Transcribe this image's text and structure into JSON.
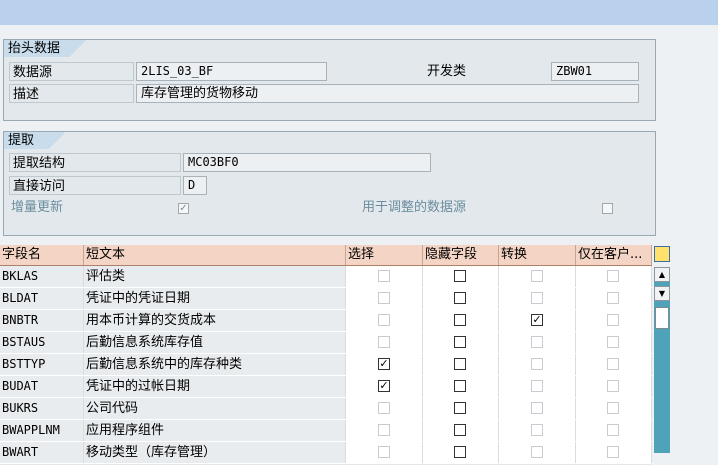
{
  "header_group": {
    "title": "抬头数据",
    "datasource_label": "数据源",
    "datasource_value": "2LIS_03_BF",
    "devclass_label": "开发类",
    "devclass_value": "ZBW01",
    "desc_label": "描述",
    "desc_value": "库存管理的货物移动"
  },
  "extract_group": {
    "title": "提取",
    "structure_label": "提取结构",
    "structure_value": "MC03BF0",
    "direct_label": "直接访问",
    "direct_value": "D",
    "delta_label": "增量更新",
    "delta_checked": true,
    "adjust_label": "用于调整的数据源",
    "adjust_checked": false
  },
  "table": {
    "columns": [
      "字段名",
      "短文本",
      "选择",
      "隐藏字段",
      "转换",
      "仅在客户..."
    ],
    "rows": [
      {
        "field": "BKLAS",
        "text": "评估类",
        "select": false,
        "hidden": false,
        "convert": false,
        "client": false
      },
      {
        "field": "BLDAT",
        "text": "凭证中的凭证日期",
        "select": false,
        "hidden": false,
        "convert": false,
        "client": false
      },
      {
        "field": "BNBTR",
        "text": "用本币计算的交货成本",
        "select": false,
        "hidden": false,
        "convert": true,
        "client": false
      },
      {
        "field": "BSTAUS",
        "text": "后勤信息系统库存值",
        "select": false,
        "hidden": false,
        "convert": false,
        "client": false
      },
      {
        "field": "BSTTYP",
        "text": "后勤信息系统中的库存种类",
        "select": true,
        "hidden": false,
        "convert": false,
        "client": false
      },
      {
        "field": "BUDAT",
        "text": "凭证中的过帐日期",
        "select": true,
        "hidden": false,
        "convert": false,
        "client": false
      },
      {
        "field": "BUKRS",
        "text": "公司代码",
        "select": false,
        "hidden": false,
        "convert": false,
        "client": false
      },
      {
        "field": "BWAPPLNM",
        "text": "应用程序组件",
        "select": false,
        "hidden": false,
        "convert": false,
        "client": false
      },
      {
        "field": "BWART",
        "text": "移动类型（库存管理）",
        "select": false,
        "hidden": false,
        "convert": false,
        "client": false
      }
    ]
  },
  "scrollbar": {
    "up_glyph": "▲",
    "down_glyph": "▼"
  }
}
